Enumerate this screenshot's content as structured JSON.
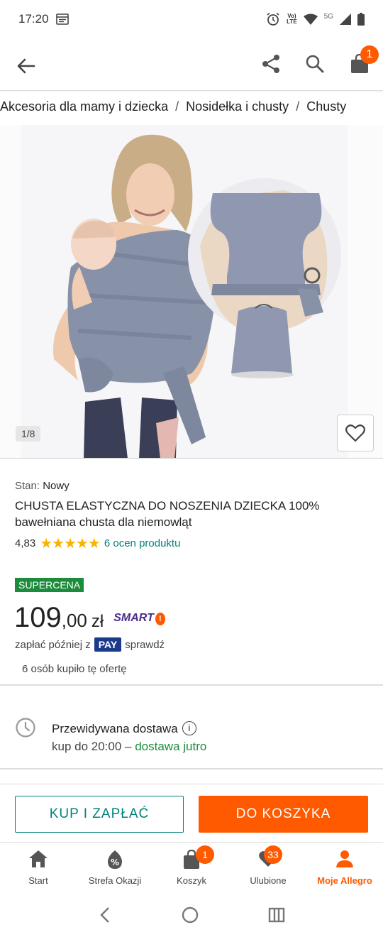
{
  "status_bar": {
    "time": "17:20",
    "network_top": "Vo)",
    "network_bottom": "LTE",
    "network_5g": "5G"
  },
  "app_bar": {
    "cart_count": "1"
  },
  "breadcrumb": [
    "Akcesoria dla mamy i dziecka",
    "Nosidełka i chusty",
    "Chusty"
  ],
  "gallery": {
    "counter": "1/8"
  },
  "product": {
    "condition_label": "Stan:",
    "condition_value": "Nowy",
    "title": "CHUSTA ELASTYCZNA DO NOSZENIA DZIECKA 100% bawełniana chusta dla niemowląt",
    "rating": "4,83",
    "stars": "★★★★★",
    "rating_count": "6 ocen produktu"
  },
  "pricing": {
    "badge": "SUPERCENA",
    "price_int": "109",
    "price_dec": ",00",
    "currency": "zł",
    "smart_label": "SMART",
    "smart_mark": "!",
    "pay_later_prefix": "zapłać później z",
    "pay_badge": "PAY",
    "pay_later_link": "sprawdź",
    "bought": "6 osób kupiło tę ofertę"
  },
  "delivery": {
    "title": "Przewidywana dostawa",
    "info_icon": "i",
    "line_prefix": "kup do 20:00 –",
    "line_highlight": "dostawa jutro"
  },
  "actions": {
    "buy_now": "KUP I ZAPŁAĆ",
    "add_to_cart": "DO KOSZYKA"
  },
  "bottom_nav": {
    "start": "Start",
    "deals": "Strefa Okazji",
    "cart": "Koszyk",
    "cart_badge": "1",
    "favorites": "Ulubione",
    "favorites_badge": "33",
    "account": "Moje Allegro"
  },
  "colors": {
    "accent": "#ff5a00",
    "teal": "#00827a",
    "green": "#1c8b3c",
    "pay_blue": "#1a3a8a"
  }
}
